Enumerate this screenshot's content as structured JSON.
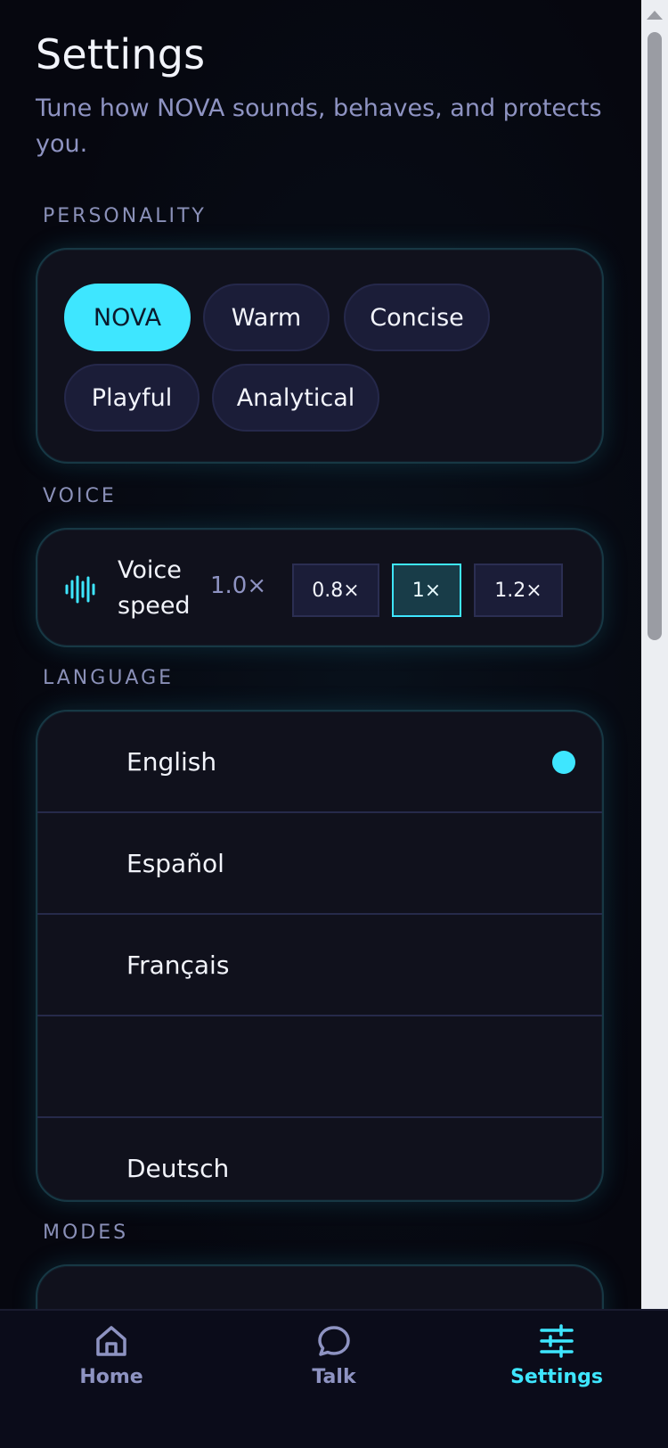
{
  "header": {
    "title": "Settings",
    "subtitle": "Tune how NOVA sounds, behaves, and protects you."
  },
  "sections": {
    "personality": "PERSONALITY",
    "voice": "VOICE",
    "language": "LANGUAGE",
    "modes": "MODES"
  },
  "personality": {
    "chips": [
      "NOVA",
      "Warm",
      "Concise",
      "Playful",
      "Analytical"
    ],
    "selected": "NOVA"
  },
  "voice": {
    "icon": "waveform-icon",
    "label": "Voice speed",
    "current_value": "1.0×",
    "options": [
      "0.8×",
      "1×",
      "1.2×"
    ],
    "selected": "1×"
  },
  "language": {
    "items": [
      "English",
      "Español",
      "Français",
      "",
      "Deutsch"
    ],
    "selected": "English"
  },
  "nav": {
    "items": [
      {
        "label": "Home",
        "icon": "home-icon"
      },
      {
        "label": "Talk",
        "icon": "chat-bubble-icon"
      },
      {
        "label": "Settings",
        "icon": "sliders-icon"
      }
    ],
    "active": "Settings"
  },
  "colors": {
    "accent": "#3ee6ff",
    "background": "#06070f",
    "card": "#10111c",
    "muted_text": "#8e93c2"
  }
}
